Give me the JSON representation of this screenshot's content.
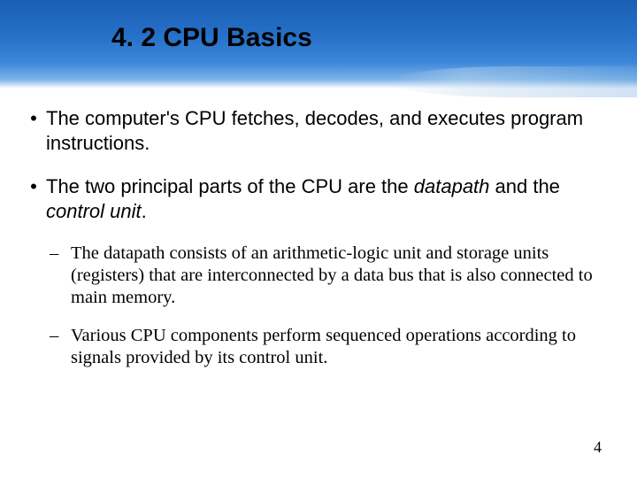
{
  "title": "4. 2 CPU Basics",
  "bullets": [
    {
      "text": "The computer's CPU fetches, decodes, and executes program instructions."
    },
    {
      "text_parts": [
        "The two principal parts of the CPU are the ",
        "datapath",
        " and the ",
        "control unit",
        "."
      ]
    }
  ],
  "sub_bullets": [
    "The datapath consists of an arithmetic-logic unit and storage units (registers) that are interconnected by a data bus that is also connected to main memory.",
    "Various CPU components perform sequenced operations according to signals provided by its control unit."
  ],
  "page_number": "4"
}
